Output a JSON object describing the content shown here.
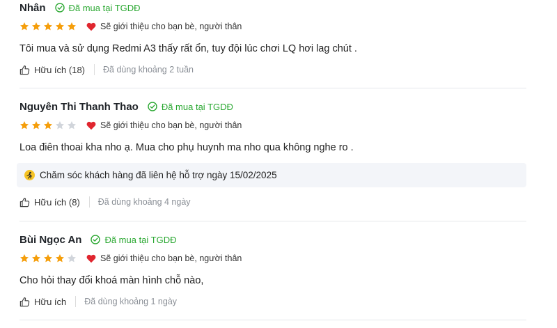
{
  "reviews": [
    {
      "name": "Nhân",
      "verified_label": "Đã mua tại TGDĐ",
      "rating": 5,
      "recommend_label": "Sẽ giới thiệu cho bạn bè, người thân",
      "content": "Tôi mua và sử dụng Redmi A3 thấy rất ổn, tuy đội lúc chơi LQ hơi lag chút .",
      "helpful_label": "Hữu ích (18)",
      "used_label": "Đã dùng khoảng 2 tuần"
    },
    {
      "name": "Nguyên Thi Thanh Thao",
      "verified_label": "Đã mua tại TGDĐ",
      "rating": 3,
      "recommend_label": "Sẽ giới thiệu cho bạn bè, người thân",
      "content": "Loa điên thoai kha nho ạ. Mua cho phụ huynh ma nho qua không nghe ro .",
      "support_label": "Chăm sóc khách hàng đã liên hệ hỗ trợ ngày 15/02/2025",
      "helpful_label": "Hữu ích (8)",
      "used_label": "Đã dùng khoảng 4 ngày"
    },
    {
      "name": "Bùi Ngọc An",
      "verified_label": "Đã mua tại TGDĐ",
      "rating": 4,
      "recommend_label": "Sẽ giới thiệu cho bạn bè, người thân",
      "content": "Cho hỏi thay đổi khoá màn hình chỗ nào,",
      "helpful_label": "Hữu ích",
      "used_label": "Đã dùng khoảng 1 ngày"
    }
  ],
  "colors": {
    "star_filled": "#f59e0b",
    "star_empty": "#d1d5db",
    "verified": "#2ba832",
    "heart": "#e0262f"
  },
  "icons": {
    "verified": "check-circle-icon",
    "recommend": "heart-icon",
    "helpful": "thumbs-up-icon",
    "support": "support-agent-icon",
    "star": "star-icon"
  }
}
